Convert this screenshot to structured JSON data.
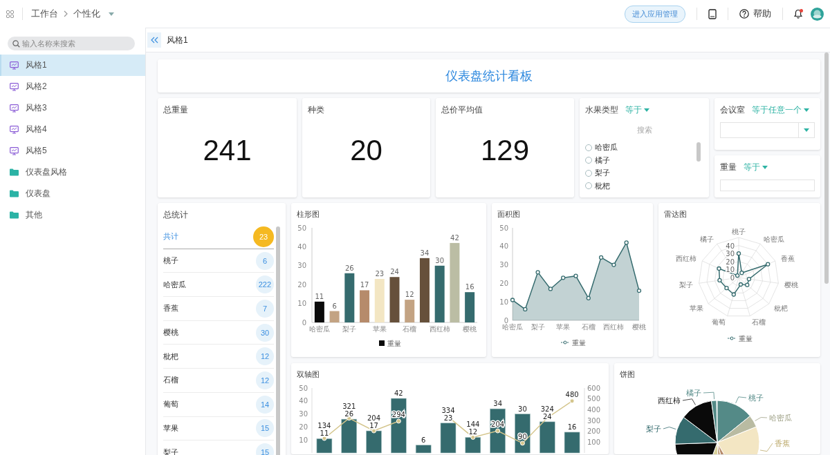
{
  "topbar": {
    "breadcrumb": [
      "工作台",
      "个性化"
    ],
    "manage_button": "进入应用管理",
    "help": "帮助",
    "unread": true
  },
  "sidebar": {
    "search": {
      "placeholder": "输入名称来搜索"
    },
    "items": [
      {
        "label": "风格1",
        "kind": "dashboard",
        "selected": true
      },
      {
        "label": "风格2",
        "kind": "dashboard",
        "selected": false
      },
      {
        "label": "风格3",
        "kind": "dashboard",
        "selected": false
      },
      {
        "label": "风格4",
        "kind": "dashboard",
        "selected": false
      },
      {
        "label": "风格5",
        "kind": "dashboard",
        "selected": false
      },
      {
        "label": "仪表盘风格",
        "kind": "folder",
        "selected": false
      },
      {
        "label": "仪表盘",
        "kind": "folder",
        "selected": false
      },
      {
        "label": "其他",
        "kind": "folder",
        "selected": false
      }
    ]
  },
  "page": {
    "title": "风格1"
  },
  "dashboard": {
    "title": "仪表盘统计看板",
    "metrics": [
      {
        "label": "总重量",
        "value": "241"
      },
      {
        "label": "种类",
        "value": "20"
      },
      {
        "label": "总价平均值",
        "value": "129"
      }
    ],
    "fruit_filter": {
      "label": "水果类型",
      "operator": "等于",
      "search": {
        "placeholder": "搜索"
      },
      "options": [
        {
          "label": "哈密瓜",
          "selected": false
        },
        {
          "label": "橘子",
          "selected": false
        },
        {
          "label": "梨子",
          "selected": false
        },
        {
          "label": "枇杷",
          "selected": false
        }
      ]
    },
    "room_filter": {
      "label": "会议室",
      "operator": "等于任意一个"
    },
    "weight_filter": {
      "label": "重量",
      "operator": "等于"
    },
    "summary": {
      "title": "总统计",
      "rows": [
        {
          "label": "共计",
          "count": "23",
          "kind": "total"
        },
        {
          "label": "桃子",
          "count": "6",
          "kind": "item"
        },
        {
          "label": "哈密瓜",
          "count": "222",
          "kind": "item"
        },
        {
          "label": "香蕉",
          "count": "7",
          "kind": "item"
        },
        {
          "label": "樱桃",
          "count": "30",
          "kind": "item"
        },
        {
          "label": "枇杷",
          "count": "12",
          "kind": "item"
        },
        {
          "label": "石榴",
          "count": "12",
          "kind": "item"
        },
        {
          "label": "葡萄",
          "count": "14",
          "kind": "item"
        },
        {
          "label": "苹果",
          "count": "15",
          "kind": "item"
        },
        {
          "label": "梨子",
          "count": "15",
          "kind": "item"
        }
      ]
    },
    "bar_chart": {
      "chart_data": {
        "type": "bar",
        "title": "柱形图",
        "categories": [
          "哈密瓜",
          null,
          "梨子",
          null,
          "苹果",
          null,
          "石榴",
          null,
          "西红柿",
          null,
          "樱桃"
        ],
        "ylim": [
          0,
          50
        ],
        "yticks": [
          0,
          10,
          20,
          30,
          40,
          50
        ],
        "data_labels": true,
        "series": [
          {
            "name": "重量",
            "values": [
              11,
              6,
              26,
              17,
              23,
              24,
              12,
              34,
              30,
              42,
              16
            ]
          }
        ]
      }
    },
    "area_chart": {
      "chart_data": {
        "type": "area",
        "title": "面积图",
        "categories": [
          "哈密瓜",
          null,
          "梨子",
          null,
          "苹果",
          null,
          "石榴",
          null,
          "西红柿",
          null,
          "樱桃"
        ],
        "ylim": [
          0,
          50
        ],
        "yticks": [
          0,
          10,
          20,
          30,
          40,
          50
        ],
        "series": [
          {
            "name": "重量",
            "color": "#356b6e",
            "values": [
              11,
              6,
              26,
              17,
              23,
              24,
              12,
              34,
              30,
              42,
              16
            ]
          }
        ]
      }
    },
    "radar_chart": {
      "title": "雷达图",
      "axes": [
        "桃子",
        "哈密瓜",
        "香蕉",
        "樱桃",
        "枇杷",
        "石榴",
        "葡萄",
        "苹果",
        "梨子",
        "西红柿",
        "橘子"
      ],
      "ticks": [
        "40",
        "30",
        "20",
        "10",
        "0"
      ],
      "legend": "重量"
    },
    "dual_chart": {
      "title": "双轴图",
      "left_ticks": [
        "50",
        "40",
        "30",
        "20",
        "10"
      ],
      "right_ticks": [
        "600",
        "500",
        "400",
        "300",
        "200",
        "100"
      ],
      "bar_labels": [
        "11",
        "26",
        "17",
        "42",
        "6",
        "23",
        "12",
        "34",
        "30",
        "24",
        "16"
      ],
      "line_labels": [
        "134",
        "321",
        "204",
        "294",
        "334",
        "144",
        "204",
        "90",
        "324",
        "480"
      ]
    },
    "pie_chart": {
      "title": "饼图",
      "kind": "picture",
      "labels": [
        "橘子",
        "桃子",
        "哈密瓜",
        "西红柿",
        "梨子",
        "香蕉"
      ]
    }
  }
}
